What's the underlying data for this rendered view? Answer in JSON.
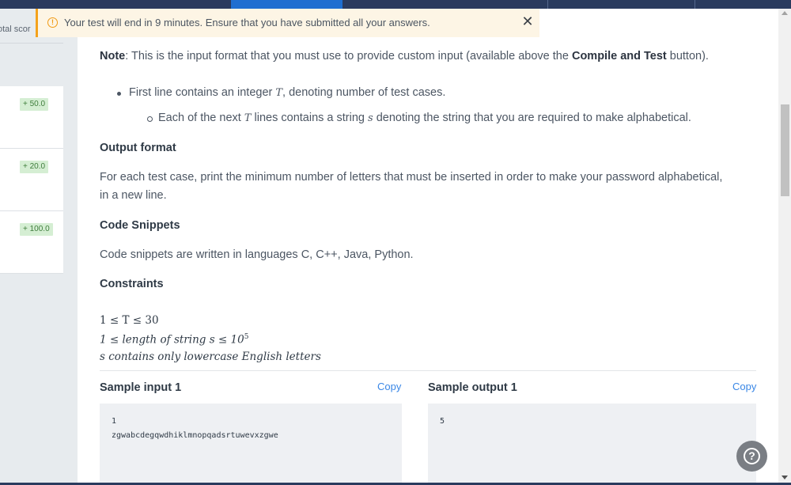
{
  "alert": {
    "message": "Your test will end in 9 minutes. Ensure that you have submitted all your answers."
  },
  "sidebar": {
    "header": "otal scor",
    "scores": [
      "+ 50.0",
      "+ 20.0",
      "+ 100.0"
    ]
  },
  "problem": {
    "note_prefix": "Note",
    "note_text_1": ": This is the input format that you must use to provide custom input (available above the ",
    "note_bold": "Compile and Test",
    "note_text_2": " button).",
    "bullet_1_pre": "First line contains an integer ",
    "bullet_1_var": "T",
    "bullet_1_post": ", denoting number of test cases.",
    "bullet_2_pre": "Each of the next ",
    "bullet_2_var": "T",
    "bullet_2_mid": " lines contains a string ",
    "bullet_2_var2": "s",
    "bullet_2_post": " denoting the string that you are required to make alphabetical.",
    "output_heading": "Output format",
    "output_line_1": "For each test case, print the minimum number of letters that must be inserted in order to make your password alphabetical,",
    "output_line_2": "in a new line.",
    "snippets_heading": "Code Snippets",
    "snippets_text": "Code snippets are written in languages C, C++, Java, Python.",
    "constraints_heading": "Constraints",
    "constraint_1": "1 ≤ T ≤ 30",
    "constraint_2_pre": "1 ≤ length of string s ≤ 10",
    "constraint_2_exp": "5",
    "constraint_3": "s contains only lowercase English letters"
  },
  "samples": {
    "input_title": "Sample input 1",
    "output_title": "Sample output 1",
    "copy_label": "Copy",
    "input_lines": [
      "1",
      "zgwabcdegqwdhiklmnopqadsrtuwevxzgwe"
    ],
    "output_lines": [
      "5"
    ]
  },
  "colors": {
    "accent": "#3a87e6",
    "topbar": "#2a3b5e",
    "alert_border": "#f4a21b",
    "score_badge": "#d5eed3"
  },
  "icons": [
    "warning-circle-icon",
    "close-icon",
    "help-icon"
  ]
}
